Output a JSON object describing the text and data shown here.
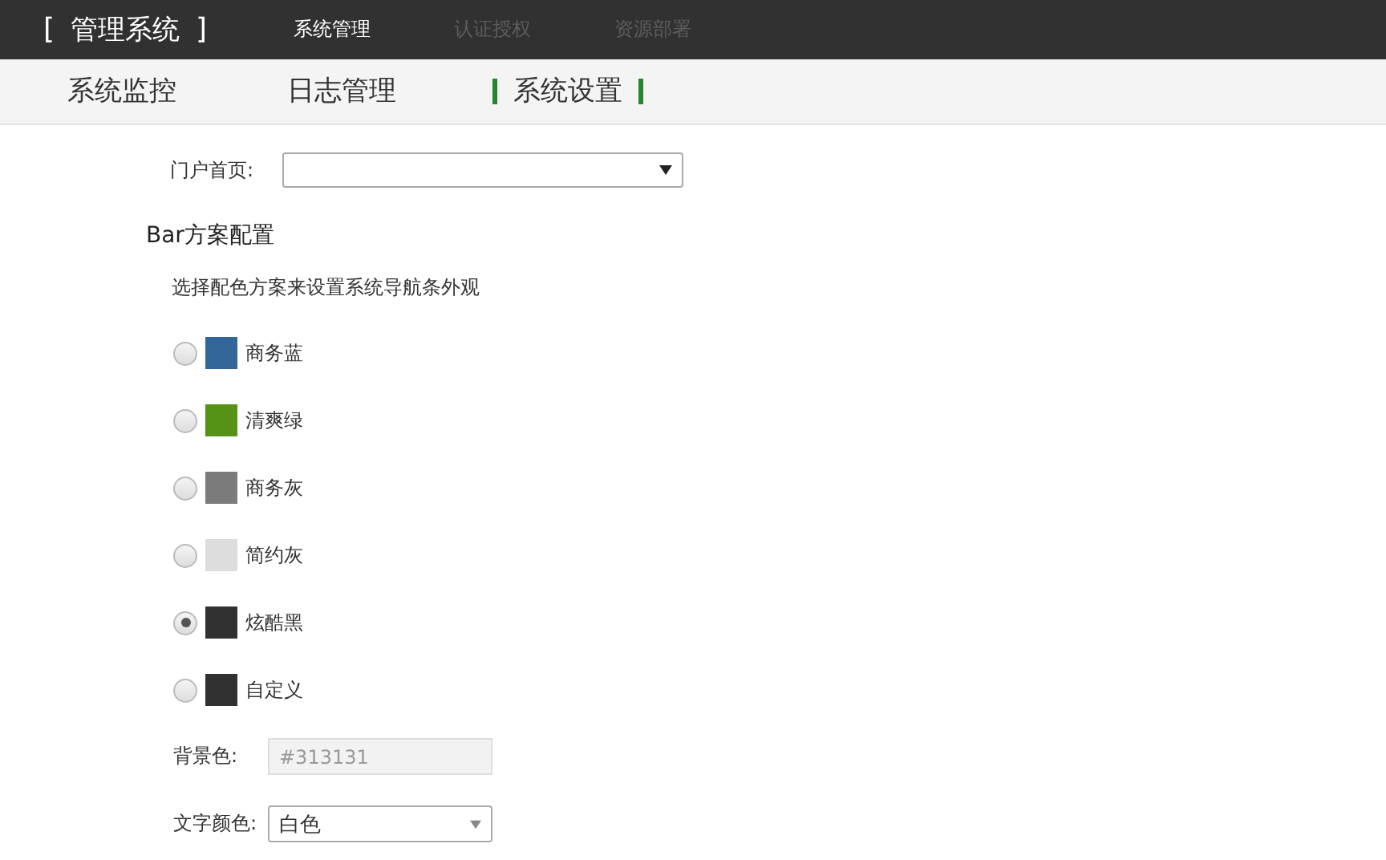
{
  "header": {
    "brand_open": "[",
    "brand": "管理系统",
    "brand_close": "]",
    "tabs": [
      {
        "label": "系统管理",
        "selected": true
      },
      {
        "label": "认证授权",
        "selected": false
      },
      {
        "label": "资源部署",
        "selected": false
      }
    ]
  },
  "subnav": [
    {
      "label": "系统监控",
      "selected": false
    },
    {
      "label": "日志管理",
      "selected": false
    },
    {
      "label": "系统设置",
      "selected": true
    }
  ],
  "portal": {
    "label": "门户首页:"
  },
  "section_title": "Bar方案配置",
  "description": "选择配色方案来设置系统导航条外观",
  "schemes": [
    {
      "label": "商务蓝",
      "color": "#336699",
      "selected": false
    },
    {
      "label": "清爽绿",
      "color": "#559216",
      "selected": false
    },
    {
      "label": "商务灰",
      "color": "#7b7b7b",
      "selected": false
    },
    {
      "label": "简约灰",
      "color": "#dddddd",
      "selected": false
    },
    {
      "label": "炫酷黑",
      "color": "#313131",
      "selected": true
    },
    {
      "label": "自定义",
      "color": "#313131",
      "selected": false
    }
  ],
  "background": {
    "label": "背景色:",
    "value": "#313131",
    "disabled": true
  },
  "text_color": {
    "label": "文字颜色:",
    "value": "白色"
  }
}
